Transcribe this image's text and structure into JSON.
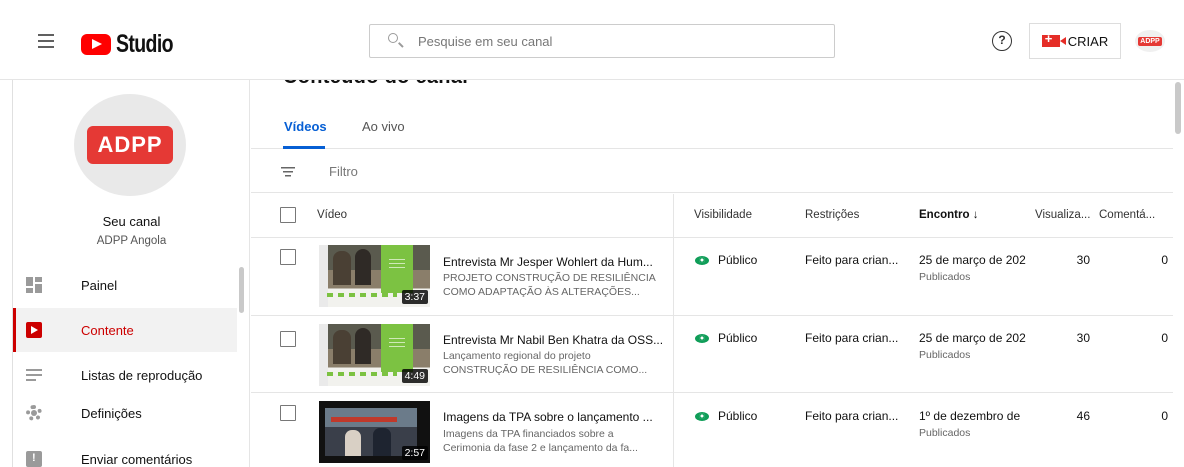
{
  "header": {
    "logo_text": "Studio",
    "search_placeholder": "Pesquise em seu canal",
    "help_glyph": "?",
    "create_label": "CRIAR",
    "avatar_text": "ADPP"
  },
  "sidebar": {
    "channel_logo_text": "ADPP",
    "your_channel": "Seu canal",
    "channel_name": "ADPP Angola",
    "items": [
      {
        "label": "Painel",
        "icon": "dashboard-icon"
      },
      {
        "label": "Contente",
        "icon": "content-icon",
        "active": true
      },
      {
        "label": "Listas de reprodução",
        "icon": "playlist-icon"
      },
      {
        "label": "Definições",
        "icon": "settings-icon"
      },
      {
        "label": "Enviar comentários",
        "icon": "feedback-icon"
      }
    ]
  },
  "main": {
    "title": "Conteúdo do canal",
    "tabs": [
      "Vídeos",
      "Ao vivo"
    ],
    "filter_label": "Filtro",
    "columns": {
      "video": "Vídeo",
      "visibility": "Visibilidade",
      "restrictions": "Restrições",
      "date": "Encontro",
      "date_sort": "↓",
      "views": "Visualiza...",
      "comments": "Comentá..."
    },
    "rows": [
      {
        "duration": "3:37",
        "title": "Entrevista Mr Jesper Wohlert da Hum...",
        "desc1": "PROJETO CONSTRUÇÃO DE RESILIÊNCIA",
        "desc2": "COMO ADAPTAÇÃO ÀS ALTERAÇÕES...",
        "visibility": "Público",
        "restriction": "Feito para crian...",
        "date": "25 de março de 202",
        "status": "Publicados",
        "views": "30",
        "comments": "0"
      },
      {
        "duration": "4:49",
        "title": "Entrevista Mr Nabil Ben Khatra da OSS...",
        "desc1": "Lançamento regional do projeto",
        "desc2": "CONSTRUÇÃO DE RESILIÊNCIA COMO...",
        "visibility": "Público",
        "restriction": "Feito para crian...",
        "date": "25 de março de 202",
        "status": "Publicados",
        "views": "30",
        "comments": "0"
      },
      {
        "duration": "2:57",
        "title": "Imagens da TPA sobre o lançamento ...",
        "desc1": "Imagens da TPA financiados sobre a",
        "desc2": "Cerimonia da fase 2 e lançamento da fa...",
        "visibility": "Público",
        "restriction": "Feito para crian...",
        "date": "1º de dezembro de",
        "status": "Publicados",
        "views": "46",
        "comments": "0"
      }
    ]
  },
  "colors": {
    "brand_red": "#ff0000",
    "active_red": "#cc0000",
    "tab_blue": "#065fd4",
    "public_green": "#0f9d58"
  }
}
